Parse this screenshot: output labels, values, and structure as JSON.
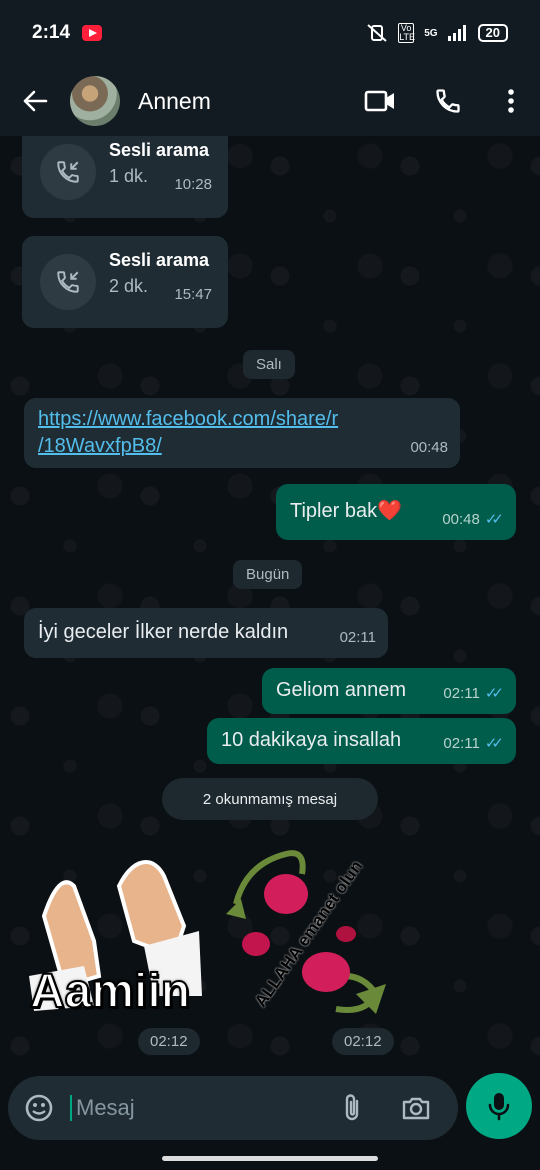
{
  "status": {
    "time": "2:14",
    "network": "5G",
    "lte": "Vo LTE",
    "battery": "20"
  },
  "header": {
    "contact_name": "Annem"
  },
  "calls": [
    {
      "title": "Sesli arama",
      "duration": "1 dk.",
      "time": "10:28"
    },
    {
      "title": "Sesli arama",
      "duration": "2 dk.",
      "time": "15:47"
    }
  ],
  "dates": {
    "tuesday": "Salı",
    "today": "Bugün"
  },
  "messages": {
    "link": {
      "text_line1": "https://www.facebook.com/share/r",
      "text_line2": "/18WavxfpB8/",
      "time": "00:48"
    },
    "tipler": {
      "text": "Tipler bak",
      "emoji": "❤️",
      "time": "00:48"
    },
    "iyi": {
      "text": "İyi geceler İlker nerde kaldın",
      "time": "02:11"
    },
    "geliom": {
      "text": "Geliom annem",
      "time": "02:11"
    },
    "dakika": {
      "text": "10 dakikaya insallah",
      "time": "02:11"
    }
  },
  "unread": "2 okunmamış mesaj",
  "stickers": [
    {
      "caption": "Aamiin",
      "time": "02:12"
    },
    {
      "caption": "ALLAHA emanet olun",
      "time": "02:12"
    }
  ],
  "composer": {
    "placeholder": "Mesaj"
  }
}
